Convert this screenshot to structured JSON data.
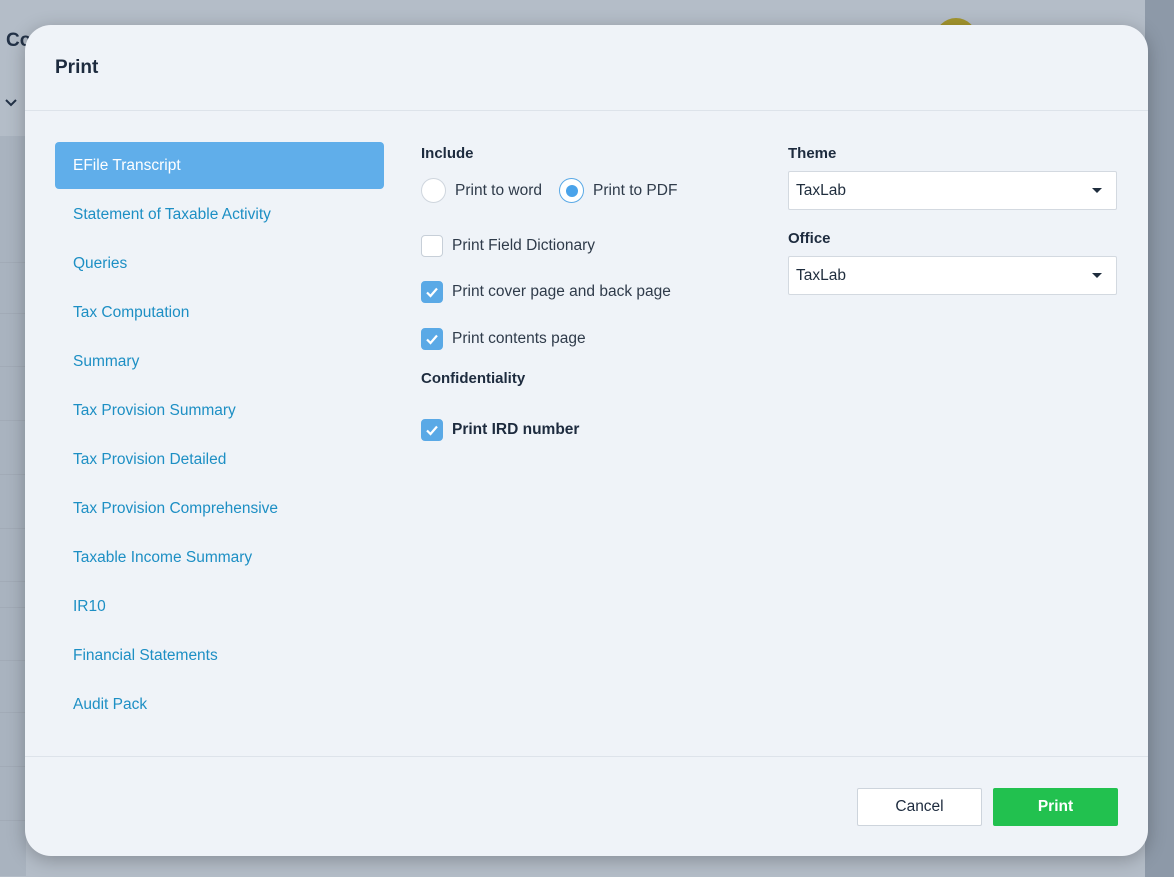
{
  "background": {
    "header_title": "Co"
  },
  "modal": {
    "title": "Print"
  },
  "nav": {
    "items": [
      {
        "label": "EFile Transcript",
        "active": true
      },
      {
        "label": "Statement of Taxable Activity",
        "active": false
      },
      {
        "label": "Queries",
        "active": false
      },
      {
        "label": "Tax Computation",
        "active": false
      },
      {
        "label": "Summary",
        "active": false
      },
      {
        "label": "Tax Provision Summary",
        "active": false
      },
      {
        "label": "Tax Provision Detailed",
        "active": false
      },
      {
        "label": "Tax Provision Comprehensive",
        "active": false
      },
      {
        "label": "Taxable Income Summary",
        "active": false
      },
      {
        "label": "IR10",
        "active": false
      },
      {
        "label": "Financial Statements",
        "active": false
      },
      {
        "label": "Audit Pack",
        "active": false
      }
    ]
  },
  "include": {
    "label": "Include",
    "print_to_word": {
      "label": "Print to word",
      "selected": false
    },
    "print_to_pdf": {
      "label": "Print to PDF",
      "selected": true
    },
    "field_dictionary": {
      "label": "Print Field Dictionary",
      "checked": false
    },
    "cover_page": {
      "label": "Print cover page and back page",
      "checked": true
    },
    "contents_page": {
      "label": "Print contents page",
      "checked": true
    }
  },
  "confidentiality": {
    "label": "Confidentiality",
    "ird_number": {
      "label": "Print IRD number",
      "checked": true
    }
  },
  "theme": {
    "label": "Theme",
    "value": "TaxLab"
  },
  "office": {
    "label": "Office",
    "value": "TaxLab"
  },
  "footer": {
    "cancel_label": "Cancel",
    "print_label": "Print"
  },
  "colors": {
    "accent": "#60aeea",
    "link": "#1d8fc4",
    "print_button": "#22c14f"
  }
}
